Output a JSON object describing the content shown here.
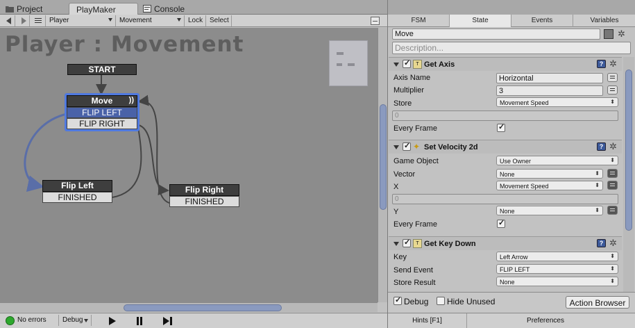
{
  "tabs": [
    {
      "label": "Project",
      "icon": "folder-icon"
    },
    {
      "label": "PlayMaker",
      "icon": ""
    },
    {
      "label": "Console",
      "icon": "console-icon"
    }
  ],
  "toolbar": {
    "fsm_owner": "Player",
    "fsm_name": "Movement",
    "lock_label": "Lock",
    "select_label": "Select"
  },
  "graph": {
    "title": "Player : Movement",
    "start_label": "START",
    "nodes": {
      "move": {
        "title": "Move",
        "transitions": [
          "FLIP LEFT",
          "FLIP RIGHT"
        ]
      },
      "flip_left": {
        "title": "Flip Left",
        "transitions": [
          "FINISHED"
        ]
      },
      "flip_right": {
        "title": "Flip Right",
        "transitions": [
          "FINISHED"
        ]
      }
    }
  },
  "debugbar": {
    "status": "No errors",
    "debug_label": "Debug",
    "status_color": "#2ea82e"
  },
  "inspector": {
    "tabs": [
      "FSM",
      "State",
      "Events",
      "Variables"
    ],
    "active_tab": "State",
    "state_name": "Move",
    "description_placeholder": "Description...",
    "actions": [
      {
        "title": "Get Axis",
        "fields": [
          {
            "label": "Axis Name",
            "value": "Horizontal"
          },
          {
            "label": "Multiplier",
            "value": "3"
          },
          {
            "label": "Store",
            "value": "Movement Speed"
          },
          {
            "label": "",
            "value": "0"
          },
          {
            "label": "Every Frame",
            "value": ""
          }
        ]
      },
      {
        "title": "Set Velocity 2d",
        "fields": [
          {
            "label": "Game Object",
            "value": "Use Owner"
          },
          {
            "label": "Vector",
            "value": "None"
          },
          {
            "label": "X",
            "value": "Movement Speed"
          },
          {
            "label": "",
            "value": "0"
          },
          {
            "label": "Y",
            "value": "None"
          },
          {
            "label": "Every Frame",
            "value": ""
          }
        ]
      },
      {
        "title": "Get Key Down",
        "fields": [
          {
            "label": "Key",
            "value": "Left Arrow"
          },
          {
            "label": "Send Event",
            "value": "FLIP LEFT"
          },
          {
            "label": "Store Result",
            "value": "None"
          }
        ]
      }
    ],
    "debug_label": "Debug",
    "hide_unused_label": "Hide Unused",
    "action_browser_label": "Action Browser",
    "hints_label": "Hints [F1]",
    "preferences_label": "Preferences",
    "accent_color": "#4f79e0"
  }
}
